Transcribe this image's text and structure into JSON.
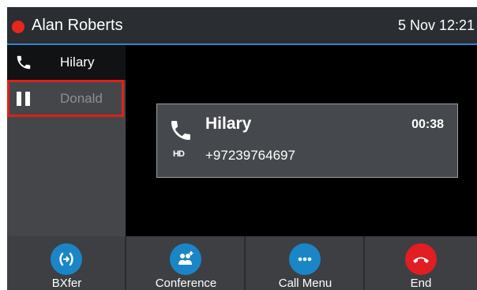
{
  "header": {
    "user_name": "Alan Roberts",
    "datetime": "5 Nov 12:21",
    "status_color": "#e8261c",
    "accent": "#2f86c9"
  },
  "lines": [
    {
      "label": "Hilary",
      "icon": "phone-icon",
      "state": "active"
    },
    {
      "label": "Donald",
      "icon": "pause-icon",
      "state": "held"
    }
  ],
  "active_call": {
    "name": "Hilary",
    "timer": "00:38",
    "number": "+97239764697",
    "codec_icon": "hd-icon"
  },
  "softkeys": [
    {
      "label": "BXfer",
      "icon": "blind-transfer-icon",
      "color": "#1a86c8"
    },
    {
      "label": "Conference",
      "icon": "conference-icon",
      "color": "#1a86c8"
    },
    {
      "label": "Call Menu",
      "icon": "more-icon",
      "color": "#1a86c8"
    },
    {
      "label": "End",
      "icon": "end-call-icon",
      "color": "#e21d23"
    }
  ]
}
